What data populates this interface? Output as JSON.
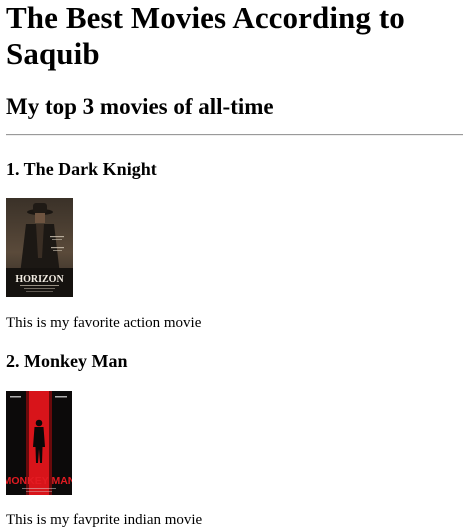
{
  "page": {
    "title": "The Best Movies According to Saquib",
    "subtitle": "My top 3 movies of all-time"
  },
  "movies": [
    {
      "heading": "1. The Dark Knight",
      "description": "This is my favorite action movie",
      "poster": {
        "icon": "movie-poster-western-icon",
        "title_text": "HORIZON",
        "accent": "#8a6a4a"
      }
    },
    {
      "heading": "2. Monkey Man",
      "description": "This is my favprite indian movie",
      "poster": {
        "icon": "movie-poster-red-silhouette-icon",
        "title_text": "MONKEY MAN",
        "accent": "#d8141a"
      }
    }
  ]
}
